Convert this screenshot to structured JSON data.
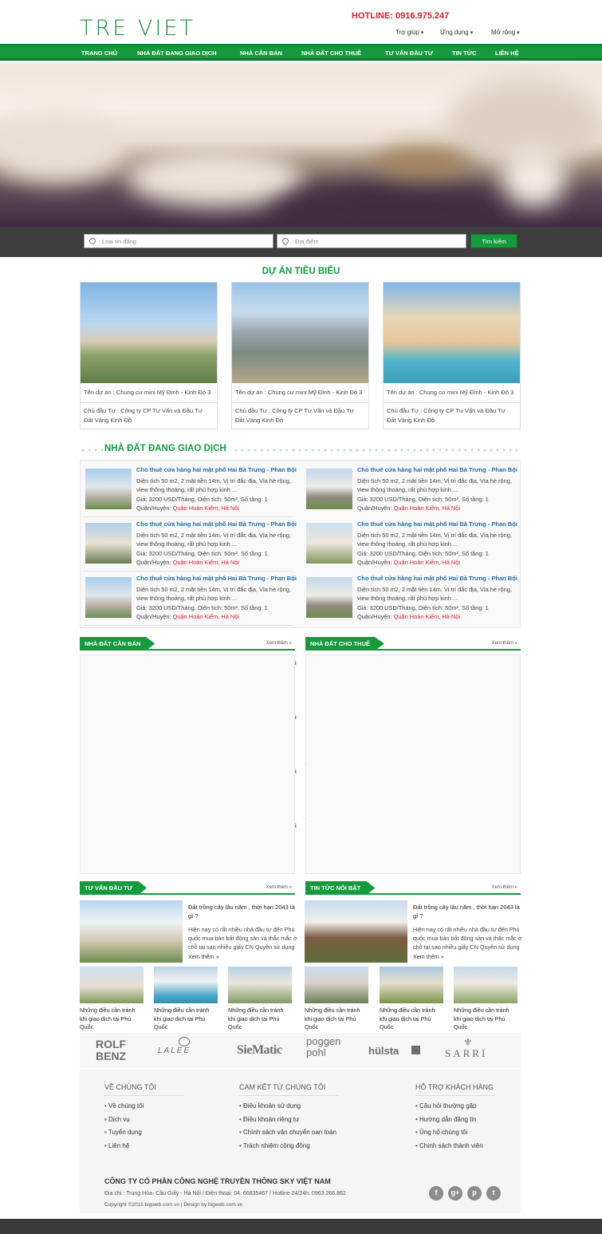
{
  "header": {
    "logo": "TRE VIET",
    "hotline": "HOTLINE: 0916.975.247",
    "top_links": [
      "Trợ giúp",
      "Ứng dụng",
      "Mở rộng"
    ]
  },
  "nav": [
    "TRANG CHỦ",
    "NHÀ ĐẤT ĐANG GIAO DỊCH",
    "NHÀ CĂN BÁN",
    "NHÀ ĐẤT CHO THUÊ",
    "TƯ VẤN ĐẦU TƯ",
    "TIN TỨC",
    "LIÊN HỆ"
  ],
  "search": {
    "type_placeholder": "Loai tin đăng",
    "location_placeholder": "Địa điểm",
    "button": "Tìm kiếm"
  },
  "featured": {
    "title": "DỰ ÁN TIÊU BIỂU",
    "projects": [
      {
        "name": "Tên dự án : Chung cư mini Mỹ Đình - Kinh Đô 3",
        "owner": "Chủ đầu Tư : Công ty CP Tư Vấn và Đầu Tư Đất Vàng Kinh Đô"
      },
      {
        "name": "Tên dự án : Chung cư mini Mỹ Đình - Kinh Đô 3",
        "owner": "Chủ đầu Tư : Công ty CP Tư Vấn và Đầu Tư Đất Vàng Kinh Đô"
      },
      {
        "name": "Tên dự án : Chung cư mini Mỹ Đình - Kinh Đô 3",
        "owner": "Chủ đầu Tư : Công ty CP Tư Vấn và Đầu Tư Đất Vàng Kinh Đô"
      }
    ]
  },
  "listing": {
    "title": "Cho thuê cửa hàng hai mặt phố Hai Bà Trưng - Phan Bội",
    "desc": "Diện tích 50 m2, 2 mặt tiền 14m, Vị trí đắc địa, Vỉa hè rộng, view thông thoáng, rất phù hợp kinh ...",
    "price": "Giá: 3200  USD/Tháng, Diện tích: 50m², Số tầng: 1",
    "district_label": "Quận/Huyện:",
    "district": "Quận Hoàn Kiếm,  Hà Nội"
  },
  "trading": {
    "title": "NHÀ ĐẤT ĐANG GIAO DỊCH"
  },
  "sale": {
    "title": "NHÀ ĐẤT CĂN BÁN",
    "more": "Xem thêm »"
  },
  "rent": {
    "title": "NHÀ ĐẤT CHO THUÊ",
    "more": "Xem thêm »"
  },
  "advice": {
    "title": "TƯ VẤN ĐẦU TƯ",
    "more": "Xem thêm »"
  },
  "news": {
    "title": "TIN TỨC NỔI BẬT",
    "more": "Xem thêm »"
  },
  "article": {
    "title": "Đất trồng cây lâu năm , thời hạn 2043 là gì ?",
    "desc": "Hiện nay có rất nhiều nhà đầu tư đến Phú quốc mua bán bất động sản và thắc mắc ở chỗ tại sao nhiều giấy CN Quyền sử dụng",
    "more": "Xem thêm »"
  },
  "gallery_caption": "Những điều cần tránh khi giao dịch tại Phú Quốc",
  "brands": [
    "ROLF BENZ",
    "LALEE",
    "SieMatic",
    "poggen pohl",
    "hülsta",
    "SARRI"
  ],
  "footer": {
    "col1": {
      "title": "VỀ CHÚNG TÔI",
      "items": [
        "Về chúng tôi",
        "Dịch vụ",
        "Tuyển dụng",
        "Liên hệ"
      ]
    },
    "col2": {
      "title": "CAM KẾT TỪ CHÚNG TÔI",
      "items": [
        "Điều khoản sử dụng",
        "Điều khoản riêng tư",
        "Chính sách vận chuyển oan toàn",
        "Trách nhiệm cộng đồng"
      ]
    },
    "col3": {
      "title": "HỖ TRỢ KHÁCH HÀNG",
      "items": [
        "Câu hỏi thường gặp",
        "Hướng dẫn đăng tin",
        "Ủng hộ chúng tôi",
        "Chính sách thành viên"
      ]
    },
    "company": "CÔNG TY CỔ PHẦN CÔNG NGHỆ TRUYỀN THÔNG SKY VIỆT NAM",
    "address": "Địa chỉ : Trung Hòa- Cầu Giấy - Hà Nội / Điện thoại: 04. 66835467 / Hotline 24/24h: 0963.266.862",
    "copyright": "Copyright ©2015 bigweb.com.vn | Design by bigweb.com.vn",
    "social": [
      "f",
      "g+",
      "p",
      "t"
    ]
  }
}
